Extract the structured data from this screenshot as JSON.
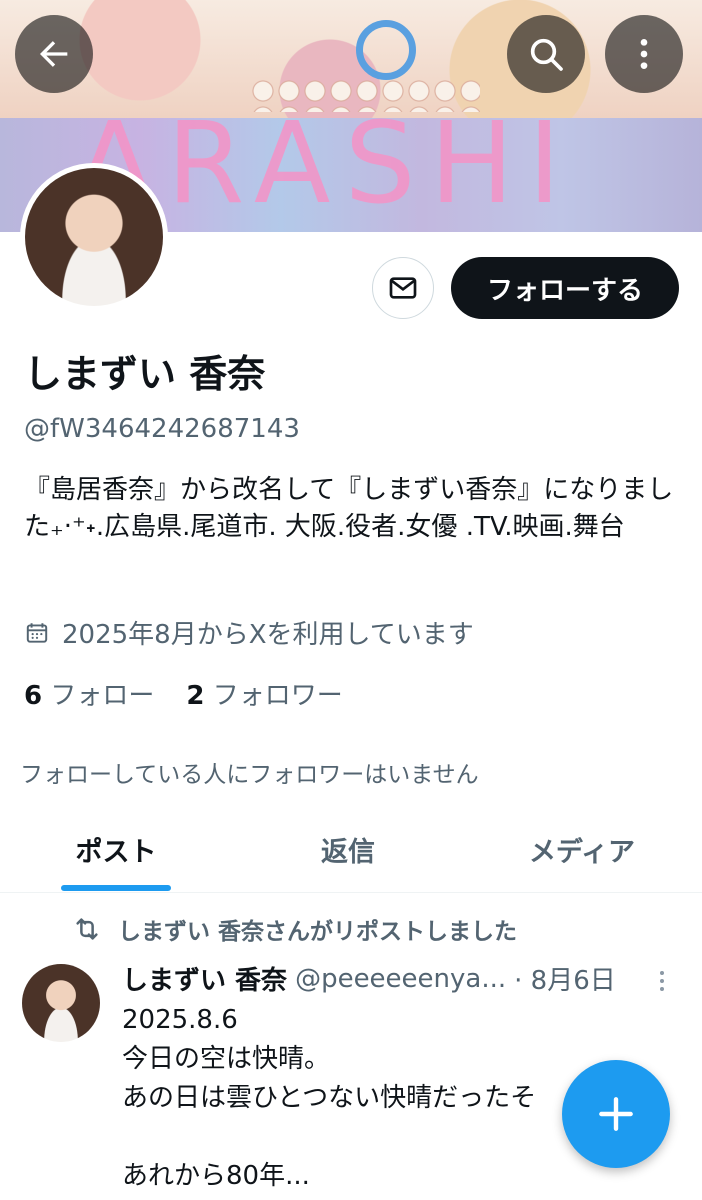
{
  "banner": {
    "art_text": "ARASHI"
  },
  "profile": {
    "display_name": "しまずい 香奈",
    "handle": "@fW3464242687143",
    "bio": "『島居香奈』から改名して『しまずい香奈』になりました₊‧⁺˖.広島県.尾道市. 大阪.役者.女優 .TV.映画.舞台",
    "joined": "2025年8月からXを利用しています",
    "following_count": "6",
    "following_label": "フォロー",
    "followers_count": "2",
    "followers_label": "フォロワー",
    "no_common_followers": "フォローしている人にフォロワーはいません"
  },
  "actions": {
    "follow_label": "フォローする"
  },
  "tabs": [
    {
      "label": "ポスト",
      "active": true
    },
    {
      "label": "返信",
      "active": false
    },
    {
      "label": "メディア",
      "active": false
    }
  ],
  "post": {
    "repost_text": "しまずい 香奈さんがリポストしました",
    "author_name": "しまずい 香奈",
    "author_handle": "@peeeeeenya...",
    "date": "· 8月6日",
    "body": "2025.8.6\n今日の空は快晴。\nあの日は雲ひとつない快晴だったそ\n\nあれから80年..."
  },
  "colors": {
    "accent": "#1d9bf0",
    "text": "#0f1419",
    "secondary": "#536471"
  }
}
